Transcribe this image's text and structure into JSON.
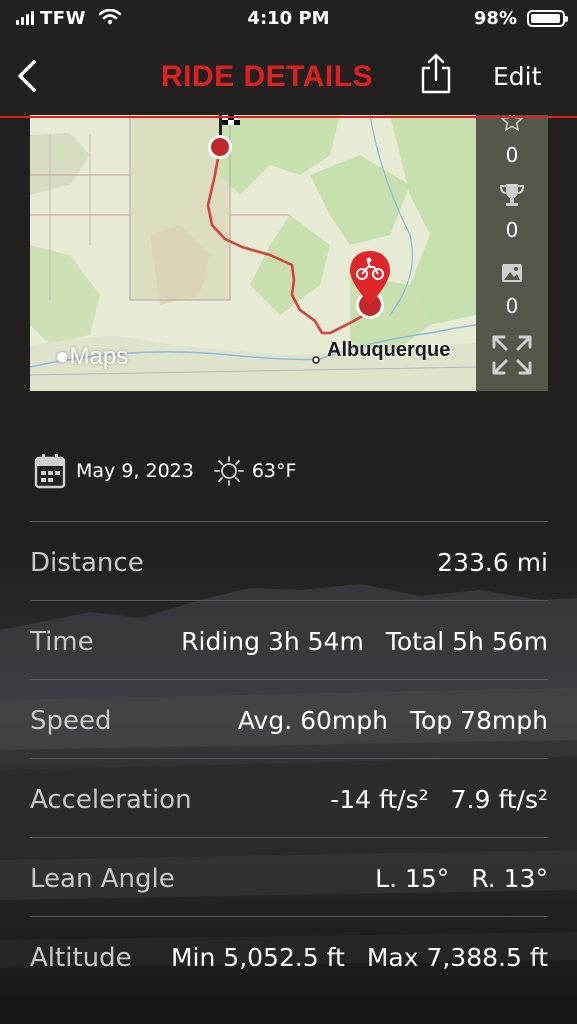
{
  "status": {
    "carrier": "TFW",
    "time": "4:10 PM",
    "battery": "98%",
    "battery_level": 0.98
  },
  "nav": {
    "title": "RIDE DETAILS",
    "edit": "Edit"
  },
  "map": {
    "attribution": "Maps",
    "city_label": "Albuquerque",
    "stats": {
      "favorites": "0",
      "trophies": "0",
      "photos": "0"
    }
  },
  "ride": {
    "date": "May 9, 2023",
    "temperature": "63°F",
    "rows": [
      {
        "label": "Distance",
        "values": [
          "233.6 mi"
        ]
      },
      {
        "label": "Time",
        "values": [
          "Riding 3h 54m",
          "Total 5h 56m"
        ]
      },
      {
        "label": "Speed",
        "values": [
          "Avg. 60mph",
          "Top 78mph"
        ]
      },
      {
        "label": "Acceleration",
        "values": [
          "-14 ft/s²",
          "7.9 ft/s²"
        ]
      },
      {
        "label": "Lean Angle",
        "values": [
          "L. 15°",
          "R. 13°"
        ]
      },
      {
        "label": "Altitude",
        "values": [
          "Min 5,052.5 ft",
          "Max 7,388.5 ft"
        ]
      }
    ]
  },
  "colors": {
    "accent": "#e0201f",
    "background": "#222120",
    "map_sidebar": "#54574c"
  }
}
